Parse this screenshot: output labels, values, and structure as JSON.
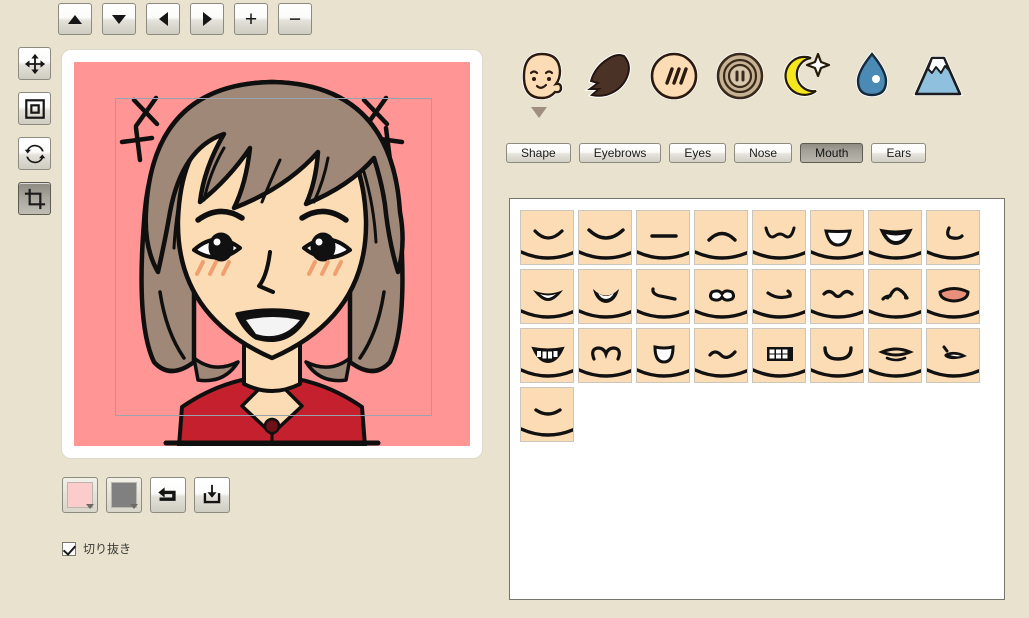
{
  "app": {
    "background_color": "#e8e2ce",
    "canvas_background_color": "#ff9595",
    "skin_color": "#fcdcb4",
    "hair_color": "#a08878",
    "shirt_color": "#c4202e"
  },
  "top_toolbar": {
    "buttons": [
      {
        "name": "move-up-button",
        "icon": "triangle-up-icon",
        "label": "▲"
      },
      {
        "name": "move-down-button",
        "icon": "triangle-down-icon",
        "label": "▼"
      },
      {
        "name": "move-left-button",
        "icon": "triangle-left-icon",
        "label": "◀"
      },
      {
        "name": "move-right-button",
        "icon": "triangle-right-icon",
        "label": "▶"
      },
      {
        "name": "zoom-in-button",
        "icon": "plus-icon",
        "label": "+"
      },
      {
        "name": "zoom-out-button",
        "icon": "minus-icon",
        "label": "−"
      }
    ]
  },
  "tool_rail": {
    "tools": [
      {
        "name": "move-tool",
        "icon": "four-way-arrow-icon",
        "active": false
      },
      {
        "name": "frame-tool",
        "icon": "nested-square-icon",
        "active": false
      },
      {
        "name": "rotate-tool",
        "icon": "circular-arrows-icon",
        "active": false
      },
      {
        "name": "crop-tool",
        "icon": "crop-icon",
        "active": true
      }
    ]
  },
  "preview": {
    "crop_guide_visible": true,
    "background_color": "#ff9595"
  },
  "bottom_controls": {
    "color_swatch_primary": {
      "name": "background-color-swatch",
      "color": "#fbcccc"
    },
    "color_swatch_secondary": {
      "name": "line-color-swatch",
      "color": "#808080"
    },
    "undo_button": {
      "name": "undo-button",
      "icon": "undo-arrow-icon"
    },
    "save_button": {
      "name": "save-button",
      "icon": "download-icon"
    }
  },
  "crop_checkbox": {
    "checked": true,
    "label": "切り抜き"
  },
  "categories": [
    {
      "name": "category-face",
      "icon": "baby-face-icon",
      "selected": true
    },
    {
      "name": "category-hair",
      "icon": "hair-icon",
      "selected": false
    },
    {
      "name": "category-body",
      "icon": "body-stripes-icon",
      "selected": false
    },
    {
      "name": "category-clothes",
      "icon": "button-icon",
      "selected": false
    },
    {
      "name": "category-accessories",
      "icon": "moon-star-icon",
      "selected": false
    },
    {
      "name": "category-effects",
      "icon": "water-drop-icon",
      "selected": false
    },
    {
      "name": "category-background",
      "icon": "mountain-icon",
      "selected": false
    }
  ],
  "tabs": [
    {
      "name": "tab-shape",
      "label": "Shape",
      "active": false
    },
    {
      "name": "tab-eyebrows",
      "label": "Eyebrows",
      "active": false
    },
    {
      "name": "tab-eyes",
      "label": "Eyes",
      "active": false
    },
    {
      "name": "tab-nose",
      "label": "Nose",
      "active": false
    },
    {
      "name": "tab-mouth",
      "label": "Mouth",
      "active": true
    },
    {
      "name": "tab-ears",
      "label": "Ears",
      "active": false
    }
  ],
  "options": {
    "count": 25,
    "items": [
      {
        "id": 1,
        "name": "mouth-smile-curve"
      },
      {
        "id": 2,
        "name": "mouth-smile-wide"
      },
      {
        "id": 3,
        "name": "mouth-straight-line"
      },
      {
        "id": 4,
        "name": "mouth-frown-arc"
      },
      {
        "id": 5,
        "name": "mouth-wavy-arch"
      },
      {
        "id": 6,
        "name": "mouth-open-half-bowl"
      },
      {
        "id": 7,
        "name": "mouth-open-grin"
      },
      {
        "id": 8,
        "name": "mouth-small-hook"
      },
      {
        "id": 9,
        "name": "mouth-thin-open-slit"
      },
      {
        "id": 10,
        "name": "mouth-open-oval-smile"
      },
      {
        "id": 11,
        "name": "mouth-diagonal-stroke"
      },
      {
        "id": 12,
        "name": "mouth-bowtie-shape"
      },
      {
        "id": 13,
        "name": "mouth-curved-tick"
      },
      {
        "id": 14,
        "name": "mouth-wavy-line"
      },
      {
        "id": 15,
        "name": "mouth-peak-wave"
      },
      {
        "id": 16,
        "name": "mouth-lips-pink-fill"
      },
      {
        "id": 17,
        "name": "mouth-teeth-grin"
      },
      {
        "id": 18,
        "name": "mouth-cat-omega"
      },
      {
        "id": 19,
        "name": "mouth-open-tongue-bowl"
      },
      {
        "id": 20,
        "name": "mouth-squiggle"
      },
      {
        "id": 21,
        "name": "mouth-braces-grid"
      },
      {
        "id": 22,
        "name": "mouth-wide-u-smile"
      },
      {
        "id": 23,
        "name": "mouth-double-lip"
      },
      {
        "id": 24,
        "name": "mouth-slanted-open"
      },
      {
        "id": 25,
        "name": "mouth-gentle-curve"
      }
    ]
  }
}
